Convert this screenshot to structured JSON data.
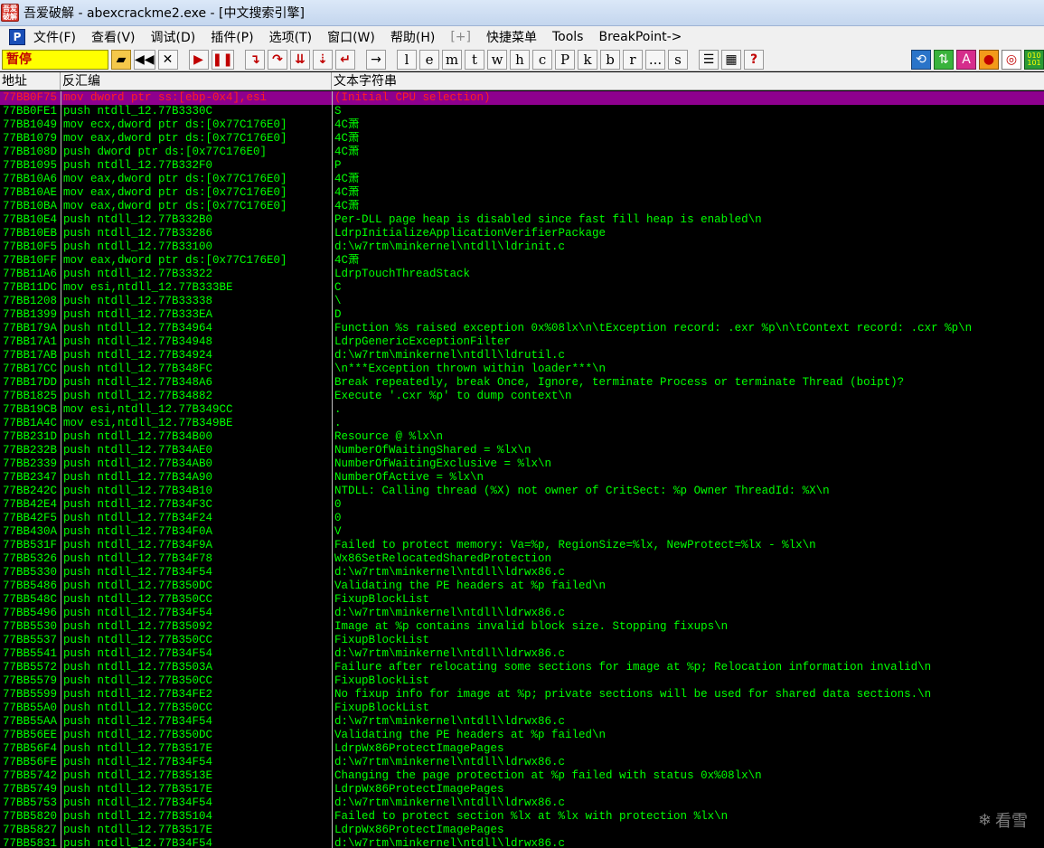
{
  "window": {
    "title": "吾爱破解 - abexcrackme2.exe - [中文搜索引擎]",
    "icon_text": "吾爱\n破解"
  },
  "menu": {
    "p_label": "P",
    "items": [
      "文件(F)",
      "查看(V)",
      "调试(D)",
      "插件(P)",
      "选项(T)",
      "窗口(W)",
      "帮助(H)",
      "[+]",
      "快捷菜单",
      "Tools",
      "BreakPoint->"
    ]
  },
  "toolbar": {
    "status": "暂停",
    "letters": [
      "l",
      "e",
      "m",
      "t",
      "w",
      "h",
      "c",
      "P",
      "k",
      "b",
      "r",
      "...",
      "s"
    ],
    "help": "?"
  },
  "columns": {
    "addr": "地址",
    "disasm": "反汇编",
    "strings": "文本字符串"
  },
  "rows": [
    [
      "77BB0F75",
      "mov dword ptr ss:[ebp-0x4],esi",
      "(Initial CPU selection)"
    ],
    [
      "77BB0FE1",
      "push ntdll_12.77B3330C",
      "S"
    ],
    [
      "77BB1049",
      "mov ecx,dword ptr ds:[0x77C176E0]",
      "4C萧"
    ],
    [
      "77BB1079",
      "mov eax,dword ptr ds:[0x77C176E0]",
      "4C萧"
    ],
    [
      "77BB108D",
      "push dword ptr ds:[0x77C176E0]",
      "4C萧"
    ],
    [
      "77BB1095",
      "push ntdll_12.77B332F0",
      "P"
    ],
    [
      "77BB10A6",
      "mov eax,dword ptr ds:[0x77C176E0]",
      "4C萧"
    ],
    [
      "77BB10AE",
      "mov eax,dword ptr ds:[0x77C176E0]",
      "4C萧"
    ],
    [
      "77BB10BA",
      "mov eax,dword ptr ds:[0x77C176E0]",
      "4C萧"
    ],
    [
      "77BB10E4",
      "push ntdll_12.77B332B0",
      "Per-DLL page heap is disabled since fast fill heap is enabled\\n"
    ],
    [
      "77BB10EB",
      "push ntdll_12.77B33286",
      "LdrpInitializeApplicationVerifierPackage"
    ],
    [
      "77BB10F5",
      "push ntdll_12.77B33100",
      "d:\\w7rtm\\minkernel\\ntdll\\ldrinit.c"
    ],
    [
      "77BB10FF",
      "mov eax,dword ptr ds:[0x77C176E0]",
      "4C萧"
    ],
    [
      "77BB11A6",
      "push ntdll_12.77B33322",
      "LdrpTouchThreadStack"
    ],
    [
      "77BB11DC",
      "mov esi,ntdll_12.77B333BE",
      "C"
    ],
    [
      "77BB1208",
      "push ntdll_12.77B33338",
      "\\"
    ],
    [
      "77BB1399",
      "push ntdll_12.77B333EA",
      "D"
    ],
    [
      "77BB179A",
      "push ntdll_12.77B34964",
      "Function %s raised exception 0x%08lx\\n\\tException record: .exr %p\\n\\tContext record: .cxr %p\\n"
    ],
    [
      "77BB17A1",
      "push ntdll_12.77B34948",
      "LdrpGenericExceptionFilter"
    ],
    [
      "77BB17AB",
      "push ntdll_12.77B34924",
      "d:\\w7rtm\\minkernel\\ntdll\\ldrutil.c"
    ],
    [
      "77BB17CC",
      "push ntdll_12.77B348FC",
      "\\n***Exception thrown within loader***\\n"
    ],
    [
      "77BB17DD",
      "push ntdll_12.77B348A6",
      "Break repeatedly, break Once, Ignore, terminate Process or terminate Thread (boipt)?"
    ],
    [
      "77BB1825",
      "push ntdll_12.77B34882",
      "Execute '.cxr %p' to dump context\\n"
    ],
    [
      "77BB19CB",
      "mov esi,ntdll_12.77B349CC",
      "."
    ],
    [
      "77BB1A4C",
      "mov esi,ntdll_12.77B349BE",
      "."
    ],
    [
      "77BB231D",
      "push ntdll_12.77B34B00",
      "Resource @ %lx\\n"
    ],
    [
      "77BB232B",
      "push ntdll_12.77B34AE0",
      " NumberOfWaitingShared = %lx\\n"
    ],
    [
      "77BB2339",
      "push ntdll_12.77B34AB0",
      " NumberOfWaitingExclusive = %lx\\n"
    ],
    [
      "77BB2347",
      "push ntdll_12.77B34A90",
      " NumberOfActive = %lx\\n"
    ],
    [
      "77BB242C",
      "push ntdll_12.77B34B10",
      "NTDLL: Calling thread (%X) not owner of CritSect: %p  Owner ThreadId: %X\\n"
    ],
    [
      "77BB42E4",
      "push ntdll_12.77B34F3C",
      "0"
    ],
    [
      "77BB42F5",
      "push ntdll_12.77B34F24",
      "0"
    ],
    [
      "77BB430A",
      "push ntdll_12.77B34F0A",
      "V"
    ],
    [
      "77BB531F",
      "push ntdll_12.77B34F9A",
      "Failed to protect memory: Va=%p, RegionSize=%lx, NewProtect=%lx - %lx\\n"
    ],
    [
      "77BB5326",
      "push ntdll_12.77B34F78",
      "Wx86SetRelocatedSharedProtection"
    ],
    [
      "77BB5330",
      "push ntdll_12.77B34F54",
      "d:\\w7rtm\\minkernel\\ntdll\\ldrwx86.c"
    ],
    [
      "77BB5486",
      "push ntdll_12.77B350DC",
      "Validating the PE headers at %p failed\\n"
    ],
    [
      "77BB548C",
      "push ntdll_12.77B350CC",
      "FixupBlockList"
    ],
    [
      "77BB5496",
      "push ntdll_12.77B34F54",
      "d:\\w7rtm\\minkernel\\ntdll\\ldrwx86.c"
    ],
    [
      "77BB5530",
      "push ntdll_12.77B35092",
      "Image at %p contains invalid block size. Stopping fixups\\n"
    ],
    [
      "77BB5537",
      "push ntdll_12.77B350CC",
      "FixupBlockList"
    ],
    [
      "77BB5541",
      "push ntdll_12.77B34F54",
      "d:\\w7rtm\\minkernel\\ntdll\\ldrwx86.c"
    ],
    [
      "77BB5572",
      "push ntdll_12.77B3503A",
      "Failure after relocating some sections for image at %p; Relocation information invalid\\n"
    ],
    [
      "77BB5579",
      "push ntdll_12.77B350CC",
      "FixupBlockList"
    ],
    [
      "77BB5599",
      "push ntdll_12.77B34FE2",
      "No fixup info for image at %p; private sections will be used for shared data sections.\\n"
    ],
    [
      "77BB55A0",
      "push ntdll_12.77B350CC",
      "FixupBlockList"
    ],
    [
      "77BB55AA",
      "push ntdll_12.77B34F54",
      "d:\\w7rtm\\minkernel\\ntdll\\ldrwx86.c"
    ],
    [
      "77BB56EE",
      "push ntdll_12.77B350DC",
      "Validating the PE headers at %p failed\\n"
    ],
    [
      "77BB56F4",
      "push ntdll_12.77B3517E",
      "LdrpWx86ProtectImagePages"
    ],
    [
      "77BB56FE",
      "push ntdll_12.77B34F54",
      "d:\\w7rtm\\minkernel\\ntdll\\ldrwx86.c"
    ],
    [
      "77BB5742",
      "push ntdll_12.77B3513E",
      "Changing the page protection at %p failed with status 0x%08lx\\n"
    ],
    [
      "77BB5749",
      "push ntdll_12.77B3517E",
      "LdrpWx86ProtectImagePages"
    ],
    [
      "77BB5753",
      "push ntdll_12.77B34F54",
      "d:\\w7rtm\\minkernel\\ntdll\\ldrwx86.c"
    ],
    [
      "77BB5820",
      "push ntdll_12.77B35104",
      "Failed to protect section %lx at %lx with protection %lx\\n"
    ],
    [
      "77BB5827",
      "push ntdll_12.77B3517E",
      "LdrpWx86ProtectImagePages"
    ],
    [
      "77BB5831",
      "push ntdll_12.77B34F54",
      "d:\\w7rtm\\minkernel\\ntdll\\ldrwx86.c"
    ]
  ],
  "watermark": {
    "text": "看雪"
  },
  "colors": {
    "text_green": "#00ff00",
    "selection_bg": "#8e008e",
    "selection_text": "#ff2020",
    "status_bg": "#ffff00"
  }
}
